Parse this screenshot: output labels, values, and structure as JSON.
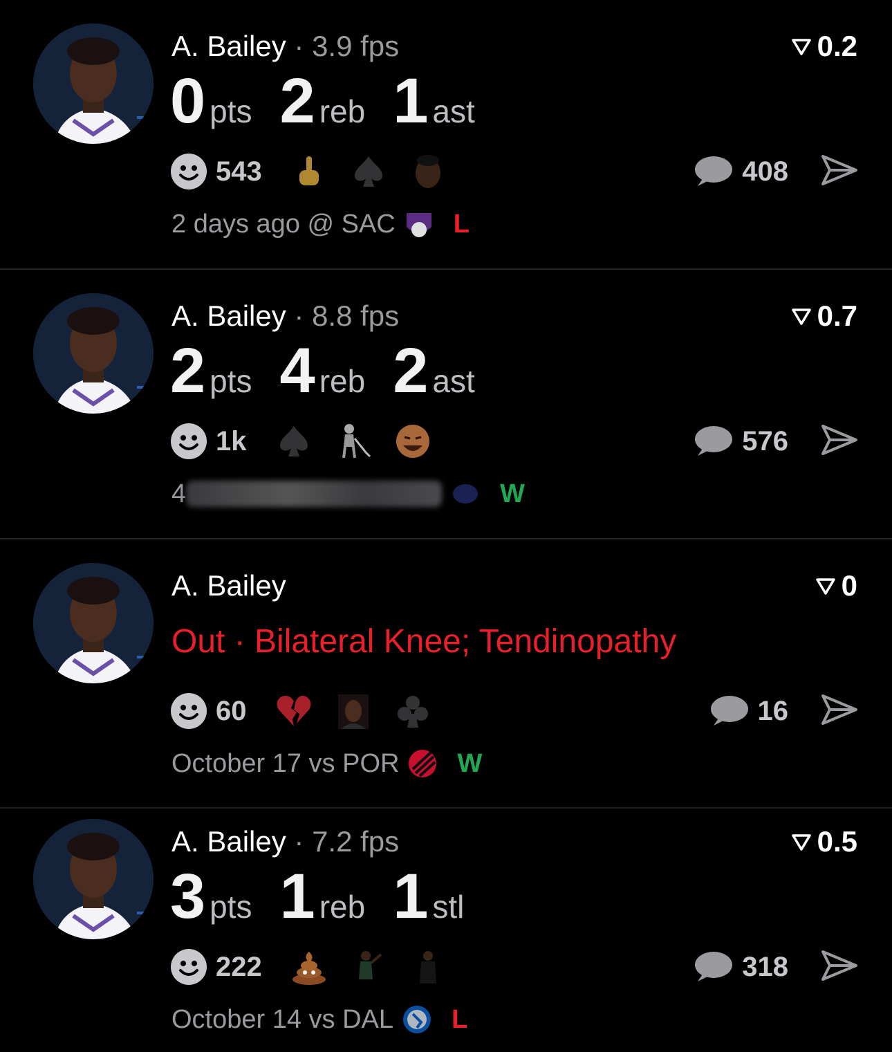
{
  "feed": [
    {
      "player": "A. Bailey",
      "fps": "3.9 fps",
      "score": "0.2",
      "stats": [
        {
          "value": "0",
          "unit": "pts"
        },
        {
          "value": "2",
          "unit": "reb"
        },
        {
          "value": "1",
          "unit": "ast"
        }
      ],
      "reaction_count": "543",
      "reactions": [
        "middle-finger-icon",
        "spade-icon",
        "face-sticker-icon"
      ],
      "comment_count": "408",
      "footer": "2 days ago @ SAC",
      "team_logo": "kings-logo-icon",
      "result": "L"
    },
    {
      "player": "A. Bailey",
      "fps": "8.8 fps",
      "score": "0.7",
      "stats": [
        {
          "value": "2",
          "unit": "pts"
        },
        {
          "value": "4",
          "unit": "reb"
        },
        {
          "value": "2",
          "unit": "ast"
        }
      ],
      "reaction_count": "1k",
      "reactions": [
        "spade-icon",
        "old-man-walker-icon",
        "laughing-man-icon"
      ],
      "comment_count": "576",
      "footer": "4",
      "team_logo": "blurred-logo-icon",
      "result": "W"
    },
    {
      "player": "A. Bailey",
      "status": "Out · Bilateral Knee; Tendinopathy",
      "score": "0",
      "reaction_count": "60",
      "reactions": [
        "broken-heart-icon",
        "laughing-woman-icon",
        "club-icon"
      ],
      "comment_count": "16",
      "footer": "October 17 vs POR",
      "team_logo": "blazers-logo-icon",
      "result": "W"
    },
    {
      "player": "A. Bailey",
      "fps": "7.2 fps",
      "score": "0.5",
      "stats": [
        {
          "value": "3",
          "unit": "pts"
        },
        {
          "value": "1",
          "unit": "reb"
        },
        {
          "value": "1",
          "unit": "stl"
        }
      ],
      "reaction_count": "222",
      "reactions": [
        "poop-icon",
        "player-gesture-icon",
        "coach-icon"
      ],
      "comment_count": "318",
      "footer": "October 14 vs DAL",
      "team_logo": "mavericks-logo-icon",
      "result": "L"
    }
  ],
  "colors": {
    "background": "#000000",
    "loss": "#e8202a",
    "win": "#22a852",
    "muted": "#9a9a9f"
  }
}
